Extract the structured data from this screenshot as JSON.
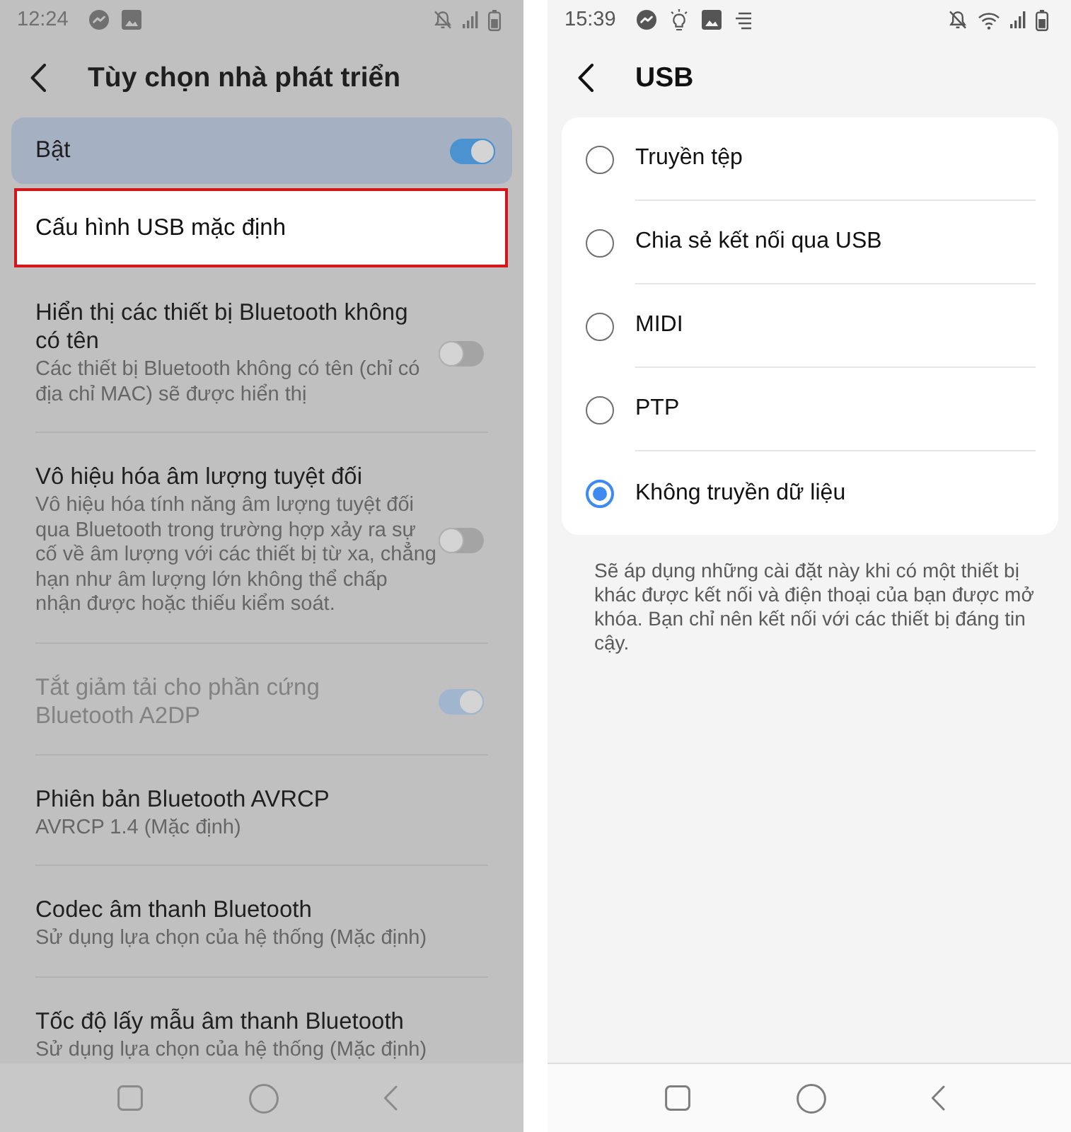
{
  "screens": [
    {
      "kind": "settings",
      "dimmed": true,
      "status_bar": {
        "time": "12:24"
      },
      "header": {
        "title": "Tùy chọn nhà phát triển"
      },
      "master_switch": {
        "label": "Bật",
        "on": true
      },
      "settings": [
        {
          "kind": "link",
          "title": "Cấu hình USB mặc định",
          "highlighted": true,
          "disabled": false
        },
        {
          "kind": "toggle",
          "title": "Hiển thị các thiết bị Bluetooth không có tên",
          "description": "Các thiết bị Bluetooth không có tên (chỉ có địa chỉ MAC) sẽ được hiển thị",
          "on": false,
          "highlighted": false,
          "disabled": false
        },
        {
          "kind": "toggle",
          "title": "Vô hiệu hóa âm lượng tuyệt đối",
          "description": "Vô hiệu hóa tính năng âm lượng tuyệt đối qua Bluetooth trong trường hợp xảy ra sự cố về âm lượng với các thiết bị từ xa, chẳng hạn như âm lượng lớn không thể chấp nhận được hoặc thiếu kiểm soát.",
          "on": false,
          "highlighted": false,
          "disabled": false
        },
        {
          "kind": "toggle",
          "title": "Tắt giảm tải cho phần cứng Bluetooth A2DP",
          "on": true,
          "highlighted": false,
          "disabled": true
        },
        {
          "kind": "link",
          "title": "Phiên bản Bluetooth AVRCP",
          "description": "AVRCP 1.4 (Mặc định)",
          "highlighted": false,
          "disabled": false
        },
        {
          "kind": "link",
          "title": "Codec âm thanh Bluetooth",
          "description": "Sử dụng lựa chọn của hệ thống (Mặc định)",
          "highlighted": false,
          "disabled": false
        },
        {
          "kind": "link",
          "title": "Tốc độ lấy mẫu âm thanh Bluetooth",
          "description": "Sử dụng lựa chọn của hệ thống (Mặc định)",
          "highlighted": false,
          "disabled": false
        }
      ]
    },
    {
      "kind": "choices",
      "dimmed": false,
      "status_bar": {
        "time": "15:39"
      },
      "header": {
        "title": "USB"
      },
      "options": [
        {
          "label": "Truyền tệp",
          "selected": false
        },
        {
          "label": "Chia sẻ kết nối qua USB",
          "selected": false
        },
        {
          "label": "MIDI",
          "selected": false
        },
        {
          "label": "PTP",
          "selected": false
        },
        {
          "label": "Không truyền dữ liệu",
          "selected": true
        }
      ],
      "note": "Sẽ áp dụng những cài đặt này khi có một thiết bị khác được kết nối và điện thoại của bạn được mở khóa. Bạn chỉ nên kết nối với các thiết bị đáng tin cậy."
    }
  ]
}
